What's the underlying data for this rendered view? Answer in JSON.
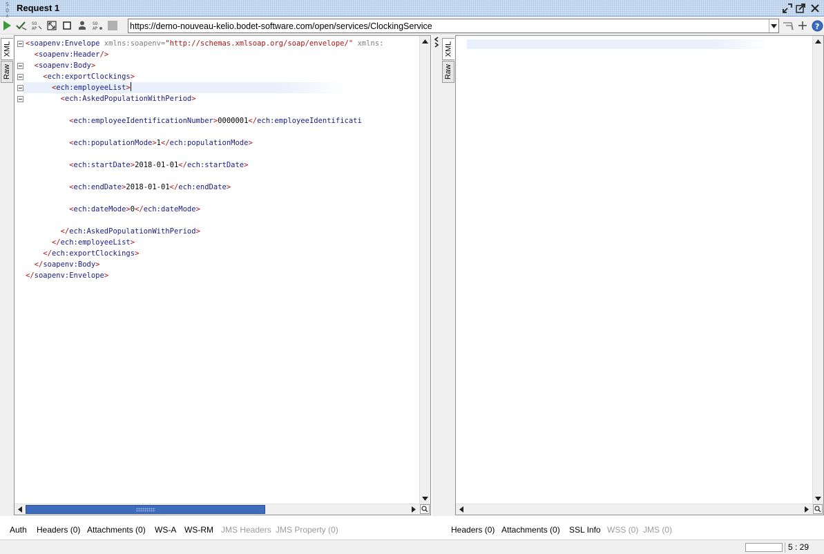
{
  "window": {
    "title": "Request 1",
    "logo_top": "S O",
    "logo_bottom": "A P"
  },
  "toolbar": {
    "url": "https://demo-nouveau-kelio.bodet-software.com/open/services/ClockingService"
  },
  "editor_tabs": {
    "xml": "XML",
    "raw": "Raw"
  },
  "request": {
    "lines": [
      {
        "indent": 0,
        "parts": [
          [
            "tag",
            "<"
          ],
          [
            "name",
            "soapenv:Envelope"
          ],
          [
            "attr",
            " xmlns:soapenv="
          ],
          [
            "val",
            "\"http://schemas.xmlsoap.org/soap/envelope/\""
          ],
          [
            "attr",
            " xmlns:"
          ]
        ]
      },
      {
        "indent": 2,
        "parts": [
          [
            "tag",
            "<"
          ],
          [
            "name",
            "soapenv:Header"
          ],
          [
            "tag",
            "/>"
          ]
        ]
      },
      {
        "indent": 2,
        "parts": [
          [
            "tag",
            "<"
          ],
          [
            "name",
            "soapenv:Body"
          ],
          [
            "tag",
            ">"
          ]
        ]
      },
      {
        "indent": 4,
        "parts": [
          [
            "tag",
            "<"
          ],
          [
            "name",
            "ech:exportClockings"
          ],
          [
            "tag",
            ">"
          ]
        ]
      },
      {
        "indent": 6,
        "parts": [
          [
            "tag",
            "<"
          ],
          [
            "name",
            "ech:employeeList"
          ],
          [
            "tag",
            ">"
          ]
        ],
        "current": true
      },
      {
        "indent": 8,
        "parts": [
          [
            "tag",
            "<"
          ],
          [
            "name",
            "ech:AskedPopulationWithPeriod"
          ],
          [
            "tag",
            ">"
          ]
        ]
      },
      {
        "indent": 0,
        "parts": []
      },
      {
        "indent": 10,
        "parts": [
          [
            "tag",
            "<"
          ],
          [
            "name",
            "ech:employeeIdentificationNumber"
          ],
          [
            "tag",
            ">"
          ],
          [
            "txt",
            "0000001"
          ],
          [
            "tag",
            "</"
          ],
          [
            "name",
            "ech:employeeIdentificati"
          ]
        ]
      },
      {
        "indent": 0,
        "parts": []
      },
      {
        "indent": 10,
        "parts": [
          [
            "tag",
            "<"
          ],
          [
            "name",
            "ech:populationMode"
          ],
          [
            "tag",
            ">"
          ],
          [
            "txt",
            "1"
          ],
          [
            "tag",
            "</"
          ],
          [
            "name",
            "ech:populationMode"
          ],
          [
            "tag",
            ">"
          ]
        ]
      },
      {
        "indent": 0,
        "parts": []
      },
      {
        "indent": 10,
        "parts": [
          [
            "tag",
            "<"
          ],
          [
            "name",
            "ech:startDate"
          ],
          [
            "tag",
            ">"
          ],
          [
            "txt",
            "2018-01-01"
          ],
          [
            "tag",
            "</"
          ],
          [
            "name",
            "ech:startDate"
          ],
          [
            "tag",
            ">"
          ]
        ]
      },
      {
        "indent": 0,
        "parts": []
      },
      {
        "indent": 10,
        "parts": [
          [
            "tag",
            "<"
          ],
          [
            "name",
            "ech:endDate"
          ],
          [
            "tag",
            ">"
          ],
          [
            "txt",
            "2018-01-01"
          ],
          [
            "tag",
            "</"
          ],
          [
            "name",
            "ech:endDate"
          ],
          [
            "tag",
            ">"
          ]
        ]
      },
      {
        "indent": 0,
        "parts": []
      },
      {
        "indent": 10,
        "parts": [
          [
            "tag",
            "<"
          ],
          [
            "name",
            "ech:dateMode"
          ],
          [
            "tag",
            ">"
          ],
          [
            "txt",
            "0"
          ],
          [
            "tag",
            "</"
          ],
          [
            "name",
            "ech:dateMode"
          ],
          [
            "tag",
            ">"
          ]
        ]
      },
      {
        "indent": 0,
        "parts": []
      },
      {
        "indent": 8,
        "parts": [
          [
            "tag",
            "</"
          ],
          [
            "name",
            "ech:AskedPopulationWithPeriod"
          ],
          [
            "tag",
            ">"
          ]
        ]
      },
      {
        "indent": 6,
        "parts": [
          [
            "tag",
            "</"
          ],
          [
            "name",
            "ech:employeeList"
          ],
          [
            "tag",
            ">"
          ]
        ]
      },
      {
        "indent": 4,
        "parts": [
          [
            "tag",
            "</"
          ],
          [
            "name",
            "ech:exportClockings"
          ],
          [
            "tag",
            ">"
          ]
        ]
      },
      {
        "indent": 2,
        "parts": [
          [
            "tag",
            "</"
          ],
          [
            "name",
            "soapenv:Body"
          ],
          [
            "tag",
            ">"
          ]
        ]
      },
      {
        "indent": 0,
        "parts": [
          [
            "tag",
            "</"
          ],
          [
            "name",
            "soapenv:Envelope"
          ],
          [
            "tag",
            ">"
          ]
        ]
      }
    ]
  },
  "request_tabs": [
    {
      "label": "Auth",
      "enabled": true
    },
    {
      "label": "Headers (0)",
      "enabled": true
    },
    {
      "label": "Attachments (0)",
      "enabled": true
    },
    {
      "label": "WS-A",
      "enabled": true
    },
    {
      "label": "WS-RM",
      "enabled": true
    },
    {
      "label": "JMS Headers",
      "enabled": false
    },
    {
      "label": "JMS Property (0)",
      "enabled": false
    }
  ],
  "response_tabs": [
    {
      "label": "Headers (0)",
      "enabled": true
    },
    {
      "label": "Attachments (0)",
      "enabled": true
    },
    {
      "label": "SSL Info",
      "enabled": true
    },
    {
      "label": "WSS (0)",
      "enabled": false
    },
    {
      "label": "JMS (0)",
      "enabled": false
    }
  ],
  "status": {
    "caret_position": "5 : 29"
  },
  "colors": {
    "accent_blue": "#3f6bbf",
    "tag_red": "#a31515",
    "name_navy": "#1a1a80",
    "run_green": "#3c9a3c"
  }
}
